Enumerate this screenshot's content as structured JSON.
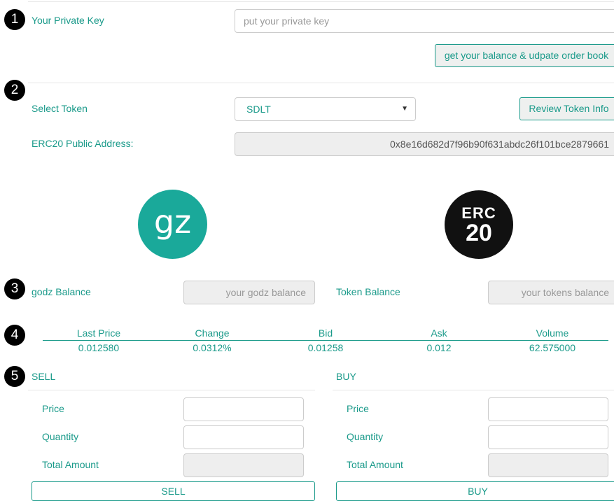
{
  "steps": [
    "1",
    "2",
    "3",
    "4",
    "5"
  ],
  "private_key": {
    "label": "Your Private Key",
    "placeholder": "put your private key",
    "button": "get your balance & udpate order book"
  },
  "token": {
    "select_label": "Select Token",
    "selected": "SDLT",
    "review_button": "Review Token Info",
    "address_label": "ERC20 Public Address:",
    "address_value": "0x8e16d682d7f96b90f631abdc26f101bce2879661"
  },
  "logos": {
    "godz_text": "gz",
    "godz_color": "#1aa99a",
    "erc_line1": "ERC",
    "erc_line2": "20",
    "erc_color": "#111111"
  },
  "balances": {
    "godz_label": "godz Balance",
    "godz_placeholder": "your godz balance",
    "token_label": "Token Balance",
    "token_placeholder": "your tokens balance"
  },
  "market": {
    "columns": [
      {
        "header": "Last Price",
        "value": "0.012580"
      },
      {
        "header": "Change",
        "value": "0.0312%"
      },
      {
        "header": "Bid",
        "value": "0.01258"
      },
      {
        "header": "Ask",
        "value": "0.012"
      },
      {
        "header": "Volume",
        "value": "62.575000"
      }
    ]
  },
  "sell": {
    "title": "SELL",
    "price_label": "Price",
    "quantity_label": "Quantity",
    "total_label": "Total Amount",
    "button": "SELL"
  },
  "buy": {
    "title": "BUY",
    "price_label": "Price",
    "quantity_label": "Quantity",
    "total_label": "Total Amount",
    "button": "BUY"
  },
  "accent_color": "#1a9a8a"
}
